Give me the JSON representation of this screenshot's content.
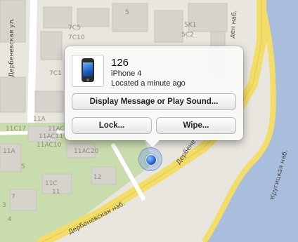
{
  "device": {
    "name": "126",
    "model": "iPhone 4",
    "status": "Located a minute ago"
  },
  "actions": {
    "display_message": "Display Message or Play Sound...",
    "lock": "Lock...",
    "wipe": "Wipe..."
  },
  "map": {
    "streets": {
      "left_vertical": "Дербеневская ул.",
      "bottom_diagonal": "Дербеневская наб.",
      "upper_diagonal": "Дербене",
      "right_vertical": "Кругицкая наб.",
      "top_right": "ден наб."
    },
    "building_labels": [
      "7C10",
      "7C5",
      "5",
      "5C2",
      "5K1",
      "7C1",
      "11A",
      "11C17",
      "11AC12",
      "11AC11",
      "11AC10",
      "11AC20",
      "11A",
      "5",
      "3",
      "11C",
      "11",
      "12",
      "7",
      "4"
    ],
    "colors": {
      "land": "#e9e6df",
      "water": "#a9bedc",
      "park": "#c9dcae",
      "road": "#f3dd6a",
      "building": "#d6d3cd"
    }
  }
}
